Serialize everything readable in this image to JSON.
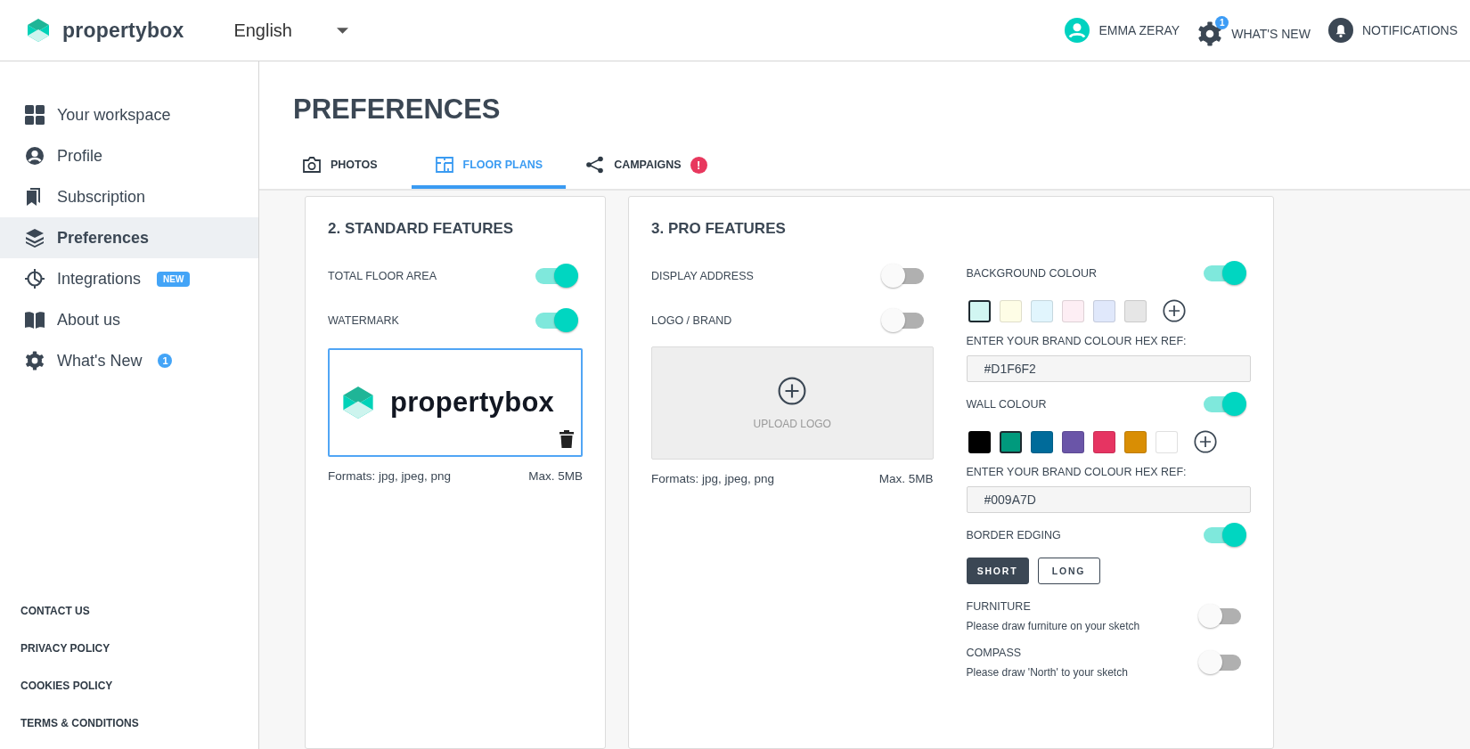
{
  "header": {
    "logo_text": "propertybox",
    "language": "English",
    "user": "EMMA ZERAY",
    "whats_new": {
      "label": "WHAT'S NEW",
      "badge": "1"
    },
    "notifications": "NOTIFICATIONS"
  },
  "sidebar": {
    "items": [
      {
        "label": "Your workspace",
        "selected": false
      },
      {
        "label": "Profile",
        "selected": false
      },
      {
        "label": "Subscription",
        "selected": false
      },
      {
        "label": "Preferences",
        "selected": true
      },
      {
        "label": "Integrations",
        "selected": false,
        "badge": {
          "kind": "pill",
          "text": "NEW"
        }
      },
      {
        "label": "About us",
        "selected": false
      },
      {
        "label": "What's New",
        "selected": false,
        "badge": {
          "kind": "count",
          "text": "1"
        }
      }
    ],
    "footer_links": [
      "CONTACT US",
      "PRIVACY POLICY",
      "COOKIES POLICY",
      "TERMS & CONDITIONS"
    ]
  },
  "page_title": "PREFERENCES",
  "tabs": [
    {
      "label": "PHOTOS",
      "selected": false
    },
    {
      "label": "FLOOR PLANS",
      "selected": true
    },
    {
      "label": "CAMPAIGNS",
      "selected": false,
      "alert": "!"
    }
  ],
  "standard": {
    "title": "2. STANDARD FEATURES",
    "toggles": [
      {
        "label": "TOTAL FLOOR AREA",
        "on": true
      },
      {
        "label": "WATERMARK",
        "on": true
      }
    ],
    "watermark": {
      "logo_text": "propertybox",
      "formats": "Formats: jpg, jpeg, png",
      "max": "Max. 5MB"
    }
  },
  "pro": {
    "title": "3. PRO FEATURES",
    "toggles": [
      {
        "label": "DISPLAY ADDRESS",
        "on": false
      },
      {
        "label": "LOGO / BRAND",
        "on": false
      }
    ],
    "upload": {
      "label": "UPLOAD LOGO",
      "formats": "Formats: jpg, jpeg, png",
      "max": "Max. 5MB"
    },
    "colour_settings": [
      {
        "label": "BACKGROUND COLOUR",
        "on": true,
        "hex_label": "ENTER YOUR BRAND COLOUR HEX REF:",
        "hex_value": "#D1F6F2",
        "swatches": [
          {
            "color": "#d1f6f2",
            "selected": true
          },
          {
            "color": "#fefde6",
            "selected": false
          },
          {
            "color": "#e1f5fd",
            "selected": false
          },
          {
            "color": "#fdeef4",
            "selected": false
          },
          {
            "color": "#e0e8fb",
            "selected": false
          },
          {
            "color": "#e6e6e6",
            "selected": false
          }
        ]
      },
      {
        "label": "WALL COLOUR",
        "on": true,
        "hex_label": "ENTER YOUR BRAND COLOUR HEX REF:",
        "hex_value": "#009A7D",
        "swatches": [
          {
            "color": "#000000",
            "selected": false
          },
          {
            "color": "#009a7d",
            "selected": true
          },
          {
            "color": "#006b9a",
            "selected": false
          },
          {
            "color": "#6a55a8",
            "selected": false
          },
          {
            "color": "#e63462",
            "selected": false
          },
          {
            "color": "#d98e04",
            "selected": false
          },
          {
            "color": "#ffffff",
            "selected": false
          }
        ]
      }
    ],
    "border_edging": {
      "label": "BORDER EDGING",
      "on": true,
      "options": [
        {
          "label": "SHORT",
          "selected": true
        },
        {
          "label": "LONG",
          "selected": false
        }
      ]
    },
    "extras": [
      {
        "label": "FURNITURE",
        "on": false,
        "description": "Please draw furniture on your sketch"
      },
      {
        "label": "COMPASS",
        "on": false,
        "description": "Please draw 'North' to your sketch"
      }
    ]
  }
}
